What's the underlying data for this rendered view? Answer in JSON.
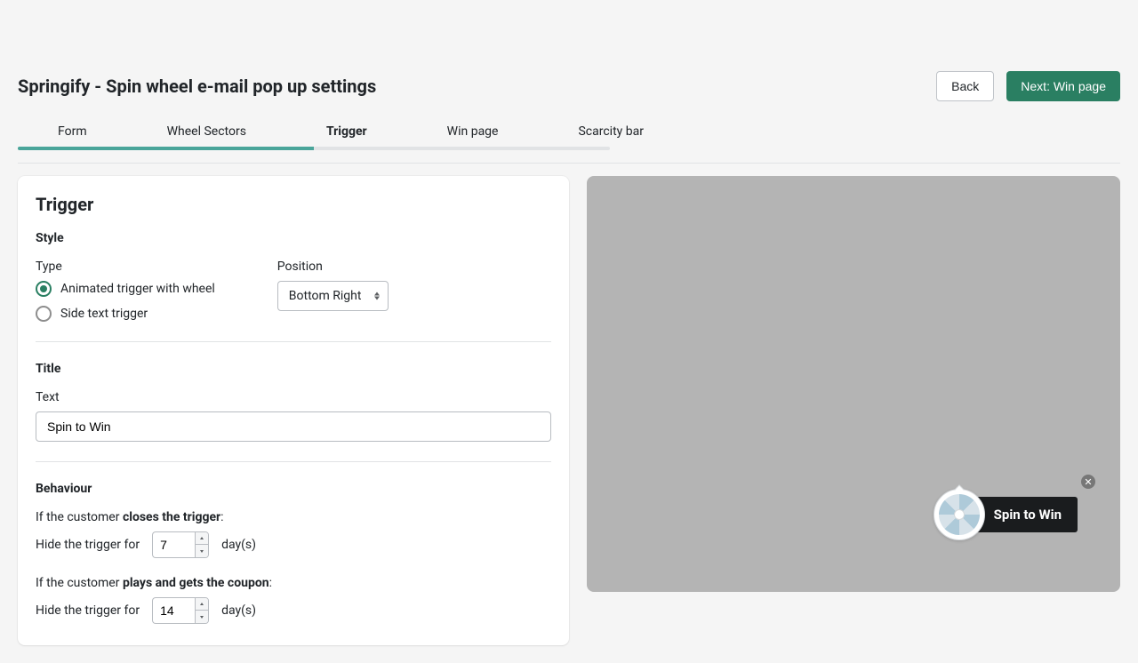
{
  "header": {
    "title": "Springify - Spin wheel e-mail pop up settings",
    "back_label": "Back",
    "next_label": "Next: Win page"
  },
  "tabs": {
    "items": [
      "Form",
      "Wheel Sectors",
      "Trigger",
      "Win page",
      "Scarcity bar"
    ],
    "active_index": 2,
    "progress_percent": 50
  },
  "panel": {
    "title": "Trigger",
    "style": {
      "heading": "Style",
      "type_label": "Type",
      "options": {
        "animated": "Animated trigger with wheel",
        "side": "Side text trigger"
      },
      "selected": "animated",
      "position_label": "Position",
      "position_value": "Bottom Right"
    },
    "title_section": {
      "heading": "Title",
      "text_label": "Text",
      "text_value": "Spin to Win"
    },
    "behaviour": {
      "heading": "Behaviour",
      "closes_prefix": "If the customer ",
      "closes_bold": "closes the trigger",
      "closes_suffix": ":",
      "hide_label": "Hide the trigger for",
      "days_unit": "day(s)",
      "closes_days": "7",
      "plays_prefix": "If the customer ",
      "plays_bold": "plays and gets the coupon",
      "plays_suffix": ":",
      "plays_days": "14"
    }
  },
  "preview": {
    "trigger_text": "Spin to Win"
  }
}
